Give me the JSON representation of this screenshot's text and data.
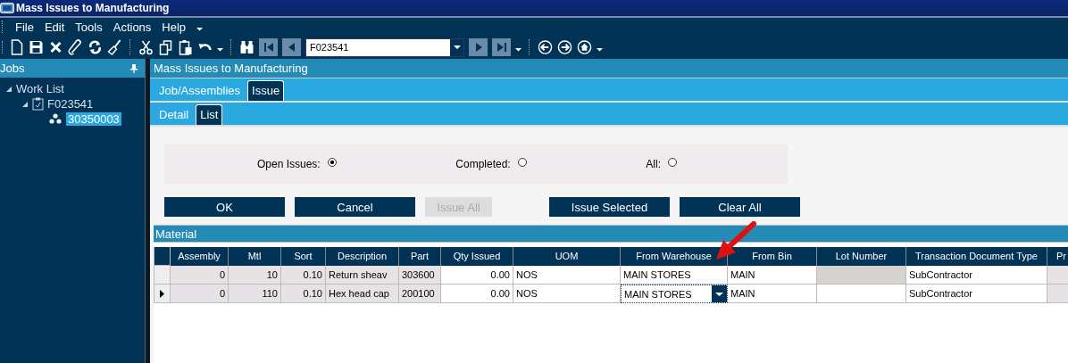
{
  "window": {
    "title": "Mass Issues to Manufacturing"
  },
  "menu": [
    "File",
    "Edit",
    "Tools",
    "Actions",
    "Help"
  ],
  "toolbar": {
    "record_field": {
      "value": "F023541"
    }
  },
  "sidebar": {
    "title": "Jobs",
    "tree": [
      {
        "label": "Work List",
        "expanded": true,
        "selected": false,
        "children": [
          {
            "label": "F023541",
            "kind": "job",
            "expanded": true,
            "selected": false,
            "children": [
              {
                "label": "30350003",
                "kind": "assembly",
                "selected": true
              }
            ]
          }
        ]
      }
    ]
  },
  "panel": {
    "title": "Mass Issues to Manufacturing"
  },
  "tabs": [
    {
      "label": "Job/Assemblies",
      "selected": false
    },
    {
      "label": "Issue",
      "selected": true
    }
  ],
  "subtabs": [
    {
      "label": "Detail",
      "selected": false
    },
    {
      "label": "List",
      "selected": true
    }
  ],
  "filter": [
    {
      "label": "Open Issues:",
      "selected": true
    },
    {
      "label": "Completed:",
      "selected": false
    },
    {
      "label": "All:",
      "selected": false
    }
  ],
  "button_groups": [
    [
      {
        "label": "OK",
        "disabled": false
      },
      {
        "label": "Cancel",
        "disabled": false
      },
      {
        "label": "Issue All",
        "disabled": true
      }
    ],
    [
      {
        "label": "Issue Selected",
        "disabled": false
      },
      {
        "label": "Clear All",
        "disabled": false
      }
    ]
  ],
  "material": {
    "title": "Material",
    "columns": [
      {
        "label": "Assembly"
      },
      {
        "label": "Mtl"
      },
      {
        "label": "Sort"
      },
      {
        "label": "Description"
      },
      {
        "label": "Part"
      },
      {
        "label": "Qty Issued"
      },
      {
        "label": "UOM"
      },
      {
        "label": "From Warehouse"
      },
      {
        "label": "From Bin"
      },
      {
        "label": "Lot Number"
      },
      {
        "label": "Transaction Document Type"
      },
      {
        "label": "Pr"
      }
    ],
    "rows": [
      {
        "current": false,
        "cells": [
          {
            "text": "0",
            "locked": true
          },
          {
            "text": "10",
            "locked": true
          },
          {
            "text": "0.10",
            "locked": true
          },
          {
            "text": "Return sheav",
            "locked": true
          },
          {
            "text": "303600",
            "locked": true
          },
          {
            "text": "0.00",
            "locked": false
          },
          {
            "text": "NOS",
            "locked": false
          },
          {
            "text": "MAIN STORES",
            "locked": false,
            "editing": false
          },
          {
            "text": "MAIN",
            "locked": false
          },
          {
            "locked": true
          },
          {
            "text": "SubContractor",
            "locked": false
          },
          {
            "locked": true
          }
        ]
      },
      {
        "current": true,
        "cells": [
          {
            "text": "0",
            "locked": true
          },
          {
            "text": "110",
            "locked": true
          },
          {
            "text": "0.10",
            "locked": true
          },
          {
            "text": "Hex head cap",
            "locked": true
          },
          {
            "text": "200100",
            "locked": true
          },
          {
            "text": "0.00",
            "locked": false
          },
          {
            "text": "NOS",
            "locked": false
          },
          {
            "text": "MAIN STORES",
            "editing": true
          },
          {
            "text": "MAIN",
            "locked": false
          },
          {
            "locked": false
          },
          {
            "text": "SubContractor",
            "locked": false
          },
          {
            "locked": true
          }
        ]
      }
    ]
  }
}
